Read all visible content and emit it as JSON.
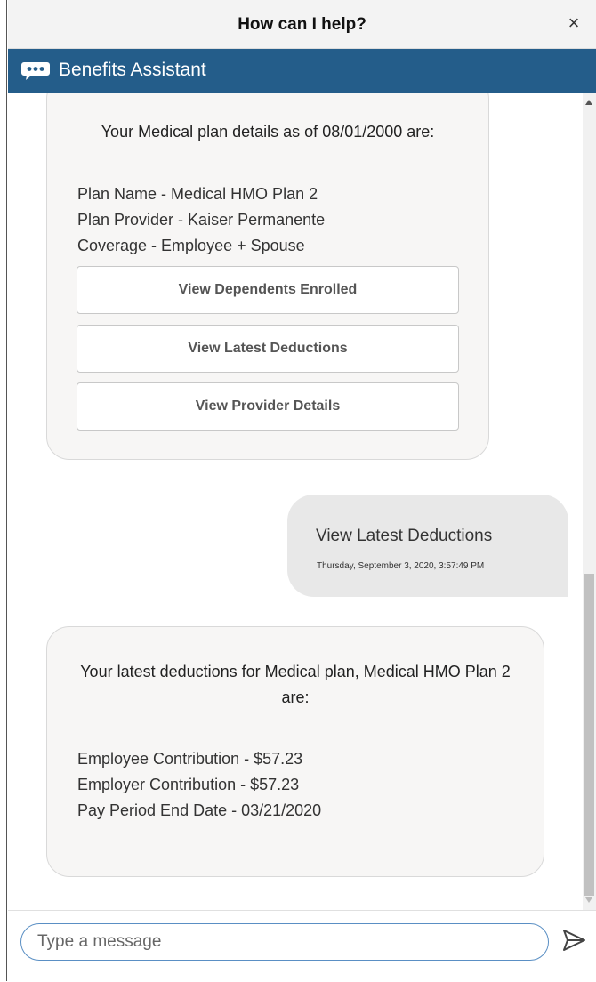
{
  "window": {
    "title": "How can I help?",
    "close_label": "×"
  },
  "header": {
    "assistant_name": "Benefits Assistant",
    "icon": "chat-bubble-icon",
    "color": "#245d8a"
  },
  "conversation": {
    "plan_message": {
      "heading": "Your Medical plan details as of 08/01/2000 are:",
      "lines": [
        "Plan Name - Medical HMO Plan 2",
        "Plan Provider - Kaiser Permanente",
        "Coverage - Employee + Spouse"
      ],
      "buttons": [
        "View Dependents Enrolled",
        "View Latest Deductions",
        "View Provider Details"
      ]
    },
    "user_message": {
      "text": "View Latest Deductions",
      "timestamp": "Thursday, September 3, 2020, 3:57:49 PM"
    },
    "deductions_message": {
      "heading": "Your latest deductions for Medical plan, Medical HMO Plan 2 are:",
      "lines": [
        "Employee Contribution - $57.23",
        "Employer Contribution - $57.23",
        "Pay Period End Date - 03/21/2020"
      ]
    }
  },
  "composer": {
    "placeholder": "Type a message",
    "send_icon": "send-icon"
  }
}
